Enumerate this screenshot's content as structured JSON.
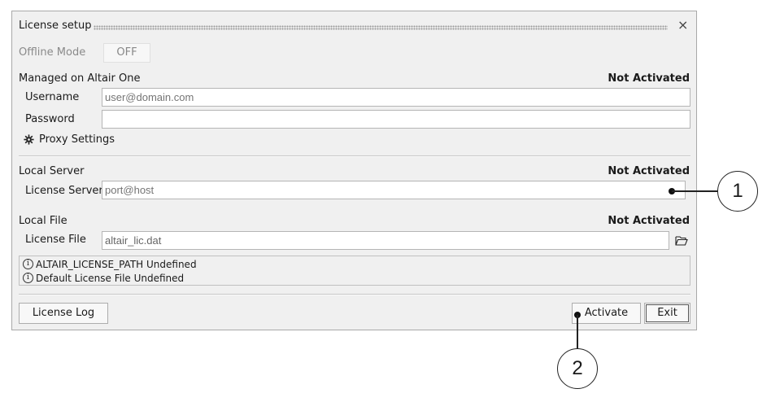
{
  "window": {
    "title": "License setup",
    "close_glyph": "×"
  },
  "offline": {
    "label": "Offline Mode",
    "toggle": "OFF"
  },
  "managed": {
    "heading": "Managed on Altair One",
    "status": "Not Activated",
    "username_label": "Username",
    "username_placeholder": "user@domain.com",
    "password_label": "Password",
    "proxy_label": "Proxy Settings",
    "proxy_icon": "gear-icon"
  },
  "local_server": {
    "heading": "Local Server",
    "status": "Not Activated",
    "server_label": "License Server",
    "server_placeholder": "port@host"
  },
  "local_file": {
    "heading": "Local File",
    "status": "Not Activated",
    "file_label": "License File",
    "file_value": "altair_lic.dat",
    "browse_icon": "folder-open-icon"
  },
  "info": {
    "line1": "ALTAIR_LICENSE_PATH Undefined",
    "line2": "Default License File Undefined"
  },
  "buttons": {
    "log": "License Log",
    "activate": "Activate",
    "exit": "Exit"
  },
  "callouts": {
    "one": "1",
    "two": "2"
  }
}
